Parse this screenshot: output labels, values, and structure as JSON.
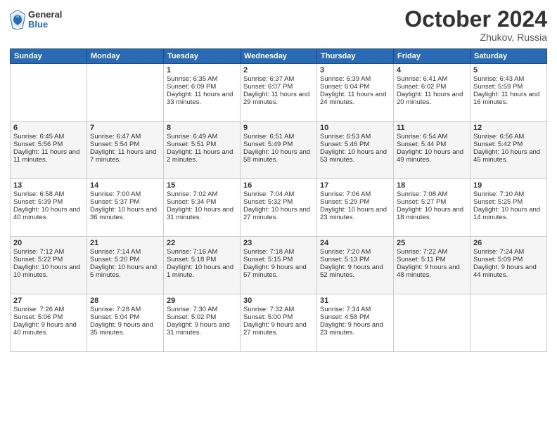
{
  "logo": {
    "general": "General",
    "blue": "Blue"
  },
  "header": {
    "month": "October 2024",
    "location": "Zhukov, Russia"
  },
  "days_of_week": [
    "Sunday",
    "Monday",
    "Tuesday",
    "Wednesday",
    "Thursday",
    "Friday",
    "Saturday"
  ],
  "weeks": [
    [
      {
        "day": "",
        "sunrise": "",
        "sunset": "",
        "daylight": "",
        "empty": true
      },
      {
        "day": "",
        "sunrise": "",
        "sunset": "",
        "daylight": "",
        "empty": true
      },
      {
        "day": "1",
        "sunrise": "Sunrise: 6:35 AM",
        "sunset": "Sunset: 6:09 PM",
        "daylight": "Daylight: 11 hours and 33 minutes."
      },
      {
        "day": "2",
        "sunrise": "Sunrise: 6:37 AM",
        "sunset": "Sunset: 6:07 PM",
        "daylight": "Daylight: 11 hours and 29 minutes."
      },
      {
        "day": "3",
        "sunrise": "Sunrise: 6:39 AM",
        "sunset": "Sunset: 6:04 PM",
        "daylight": "Daylight: 11 hours and 24 minutes."
      },
      {
        "day": "4",
        "sunrise": "Sunrise: 6:41 AM",
        "sunset": "Sunset: 6:02 PM",
        "daylight": "Daylight: 11 hours and 20 minutes."
      },
      {
        "day": "5",
        "sunrise": "Sunrise: 6:43 AM",
        "sunset": "Sunset: 5:59 PM",
        "daylight": "Daylight: 11 hours and 16 minutes."
      }
    ],
    [
      {
        "day": "6",
        "sunrise": "Sunrise: 6:45 AM",
        "sunset": "Sunset: 5:56 PM",
        "daylight": "Daylight: 11 hours and 11 minutes."
      },
      {
        "day": "7",
        "sunrise": "Sunrise: 6:47 AM",
        "sunset": "Sunset: 5:54 PM",
        "daylight": "Daylight: 11 hours and 7 minutes."
      },
      {
        "day": "8",
        "sunrise": "Sunrise: 6:49 AM",
        "sunset": "Sunset: 5:51 PM",
        "daylight": "Daylight: 11 hours and 2 minutes."
      },
      {
        "day": "9",
        "sunrise": "Sunrise: 6:51 AM",
        "sunset": "Sunset: 5:49 PM",
        "daylight": "Daylight: 10 hours and 58 minutes."
      },
      {
        "day": "10",
        "sunrise": "Sunrise: 6:53 AM",
        "sunset": "Sunset: 5:46 PM",
        "daylight": "Daylight: 10 hours and 53 minutes."
      },
      {
        "day": "11",
        "sunrise": "Sunrise: 6:54 AM",
        "sunset": "Sunset: 5:44 PM",
        "daylight": "Daylight: 10 hours and 49 minutes."
      },
      {
        "day": "12",
        "sunrise": "Sunrise: 6:56 AM",
        "sunset": "Sunset: 5:42 PM",
        "daylight": "Daylight: 10 hours and 45 minutes."
      }
    ],
    [
      {
        "day": "13",
        "sunrise": "Sunrise: 6:58 AM",
        "sunset": "Sunset: 5:39 PM",
        "daylight": "Daylight: 10 hours and 40 minutes."
      },
      {
        "day": "14",
        "sunrise": "Sunrise: 7:00 AM",
        "sunset": "Sunset: 5:37 PM",
        "daylight": "Daylight: 10 hours and 36 minutes."
      },
      {
        "day": "15",
        "sunrise": "Sunrise: 7:02 AM",
        "sunset": "Sunset: 5:34 PM",
        "daylight": "Daylight: 10 hours and 31 minutes."
      },
      {
        "day": "16",
        "sunrise": "Sunrise: 7:04 AM",
        "sunset": "Sunset: 5:32 PM",
        "daylight": "Daylight: 10 hours and 27 minutes."
      },
      {
        "day": "17",
        "sunrise": "Sunrise: 7:06 AM",
        "sunset": "Sunset: 5:29 PM",
        "daylight": "Daylight: 10 hours and 23 minutes."
      },
      {
        "day": "18",
        "sunrise": "Sunrise: 7:08 AM",
        "sunset": "Sunset: 5:27 PM",
        "daylight": "Daylight: 10 hours and 18 minutes."
      },
      {
        "day": "19",
        "sunrise": "Sunrise: 7:10 AM",
        "sunset": "Sunset: 5:25 PM",
        "daylight": "Daylight: 10 hours and 14 minutes."
      }
    ],
    [
      {
        "day": "20",
        "sunrise": "Sunrise: 7:12 AM",
        "sunset": "Sunset: 5:22 PM",
        "daylight": "Daylight: 10 hours and 10 minutes."
      },
      {
        "day": "21",
        "sunrise": "Sunrise: 7:14 AM",
        "sunset": "Sunset: 5:20 PM",
        "daylight": "Daylight: 10 hours and 5 minutes."
      },
      {
        "day": "22",
        "sunrise": "Sunrise: 7:16 AM",
        "sunset": "Sunset: 5:18 PM",
        "daylight": "Daylight: 10 hours and 1 minute."
      },
      {
        "day": "23",
        "sunrise": "Sunrise: 7:18 AM",
        "sunset": "Sunset: 5:15 PM",
        "daylight": "Daylight: 9 hours and 57 minutes."
      },
      {
        "day": "24",
        "sunrise": "Sunrise: 7:20 AM",
        "sunset": "Sunset: 5:13 PM",
        "daylight": "Daylight: 9 hours and 52 minutes."
      },
      {
        "day": "25",
        "sunrise": "Sunrise: 7:22 AM",
        "sunset": "Sunset: 5:11 PM",
        "daylight": "Daylight: 9 hours and 48 minutes."
      },
      {
        "day": "26",
        "sunrise": "Sunrise: 7:24 AM",
        "sunset": "Sunset: 5:09 PM",
        "daylight": "Daylight: 9 hours and 44 minutes."
      }
    ],
    [
      {
        "day": "27",
        "sunrise": "Sunrise: 7:26 AM",
        "sunset": "Sunset: 5:06 PM",
        "daylight": "Daylight: 9 hours and 40 minutes."
      },
      {
        "day": "28",
        "sunrise": "Sunrise: 7:28 AM",
        "sunset": "Sunset: 5:04 PM",
        "daylight": "Daylight: 9 hours and 35 minutes."
      },
      {
        "day": "29",
        "sunrise": "Sunrise: 7:30 AM",
        "sunset": "Sunset: 5:02 PM",
        "daylight": "Daylight: 9 hours and 31 minutes."
      },
      {
        "day": "30",
        "sunrise": "Sunrise: 7:32 AM",
        "sunset": "Sunset: 5:00 PM",
        "daylight": "Daylight: 9 hours and 27 minutes."
      },
      {
        "day": "31",
        "sunrise": "Sunrise: 7:34 AM",
        "sunset": "Sunset: 4:58 PM",
        "daylight": "Daylight: 9 hours and 23 minutes."
      },
      {
        "day": "",
        "sunrise": "",
        "sunset": "",
        "daylight": "",
        "empty": true
      },
      {
        "day": "",
        "sunrise": "",
        "sunset": "",
        "daylight": "",
        "empty": true
      }
    ]
  ]
}
